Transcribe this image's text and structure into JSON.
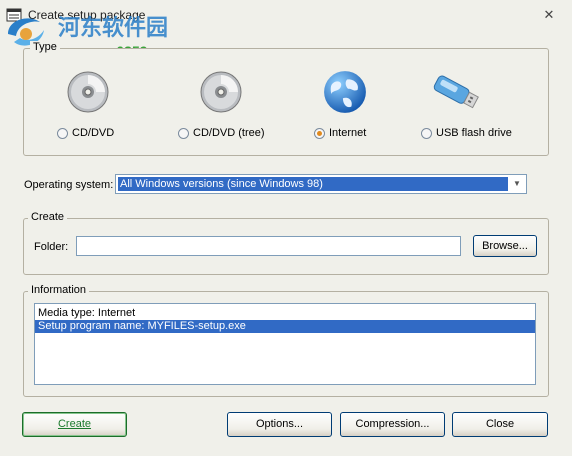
{
  "window": {
    "title": "Create setup package",
    "close_glyph": "✕",
    "watermark_text": "河东软件园",
    "watermark_url": "www.pc0359.cn"
  },
  "type_group": {
    "legend": "Type",
    "options": [
      {
        "label": "CD/DVD",
        "icon": "cd-disc-icon",
        "checked": false
      },
      {
        "label": "CD/DVD (tree)",
        "icon": "cd-disc-icon",
        "checked": false
      },
      {
        "label": "Internet",
        "icon": "globe-icon",
        "checked": true
      },
      {
        "label": "USB flash drive",
        "icon": "usb-drive-icon",
        "checked": false
      }
    ]
  },
  "os": {
    "label": "Operating system:",
    "selected": "All Windows versions (since Windows 98)"
  },
  "create_group": {
    "legend": "Create",
    "folder_label": "Folder:",
    "folder_value": "",
    "browse_label": "Browse..."
  },
  "info_group": {
    "legend": "Information",
    "items": [
      {
        "text": "Media type: Internet",
        "selected": false
      },
      {
        "text": "Setup program name: MYFILES-setup.exe",
        "selected": true
      }
    ]
  },
  "buttons": {
    "create": "Create",
    "options": "Options...",
    "compression": "Compression...",
    "close": "Close"
  },
  "colors": {
    "selection": "#316ac5",
    "radio_checked": "#e08a1e",
    "create_text": "#1c7a2e"
  }
}
